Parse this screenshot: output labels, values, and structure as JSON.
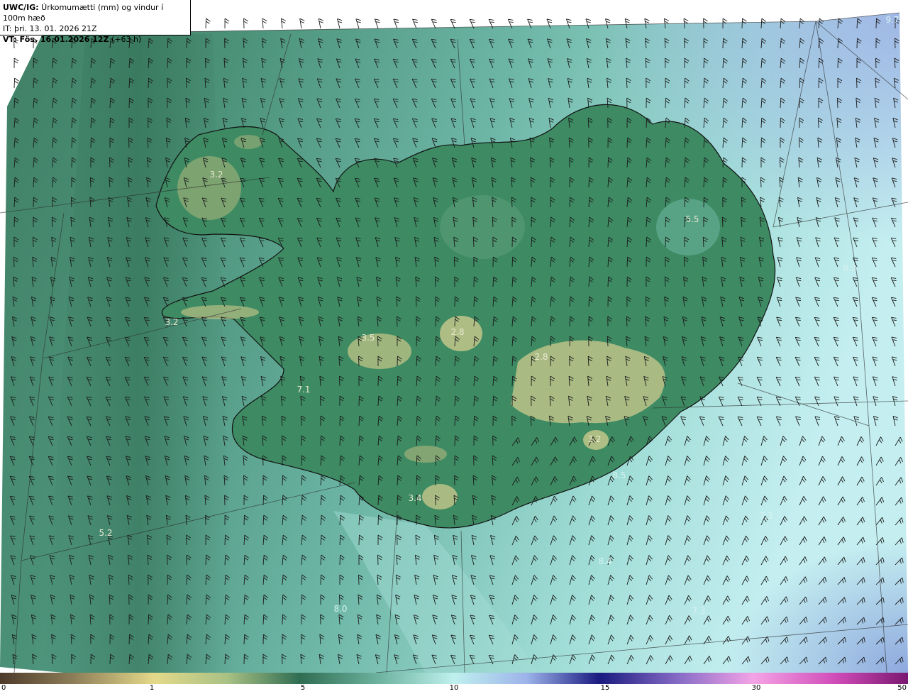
{
  "header": {
    "model_prefix": "UWC/IG:",
    "title": " Úrkomumætti (mm) og vindur í 100m hæð",
    "initial_time": "IT: þri. 13. 01. 2026 21Z",
    "valid_prefix": "VT: Fös. 16.01.2026 12Z",
    "valid_suffix": " (+63 h)"
  },
  "colorbar": {
    "ticks": [
      "0",
      "1",
      "5",
      "10",
      "15",
      "30",
      "50"
    ]
  },
  "value_labels": [
    "3.2",
    "5.5",
    "3.2",
    "3.5",
    "2.8",
    "2.8",
    "7.1",
    "3.2",
    "3.4",
    "5.2",
    "7.3",
    "8.4",
    "7.3",
    "8.0",
    "9.7",
    "8.5",
    "8.3"
  ],
  "colors": {
    "low": "#2f6d52",
    "mid": "#5aa590",
    "high": "#b9ecea",
    "land_high": "#c2c58a",
    "coast": "#111111"
  }
}
